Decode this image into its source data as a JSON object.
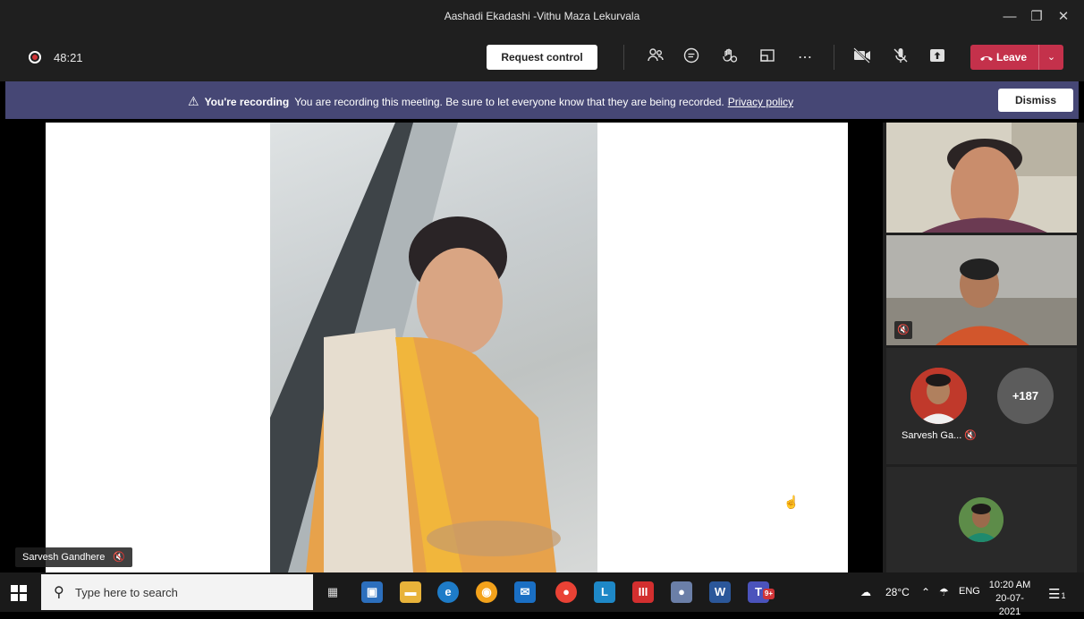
{
  "window": {
    "title": "Aashadi Ekadashi -Vithu Maza Lekurvala",
    "minimize_icon": "minimize-icon",
    "restore_icon": "restore-icon",
    "close_icon": "close-icon"
  },
  "toolbar": {
    "timer": "48:21",
    "request_control_label": "Request control",
    "leave_label": "Leave",
    "icons": [
      "people-icon",
      "chat-icon",
      "raise-hand-icon",
      "breakout-icon",
      "more-icon",
      "camera-off-icon",
      "mic-off-icon",
      "share-icon"
    ]
  },
  "banner": {
    "title": "You're recording",
    "message": "You are recording this meeting. Be sure to let everyone know that they are being recorded.",
    "link": "Privacy policy",
    "dismiss_label": "Dismiss"
  },
  "stage": {
    "speaker_name": "Sarvesh Gandhere"
  },
  "participants": {
    "tile3_name": "Sarvesh Ga...",
    "overflow_count": "+187"
  },
  "taskbar": {
    "search_placeholder": "Type here to search",
    "temperature": "28°C",
    "language": "ENG",
    "time": "10:20 AM",
    "date": "20-07-2021",
    "teams_badge": "9+",
    "notification_count": "1"
  },
  "colors": {
    "banner_bg": "#464775",
    "leave_bg": "#c4314b",
    "recording_red": "#d13438"
  }
}
